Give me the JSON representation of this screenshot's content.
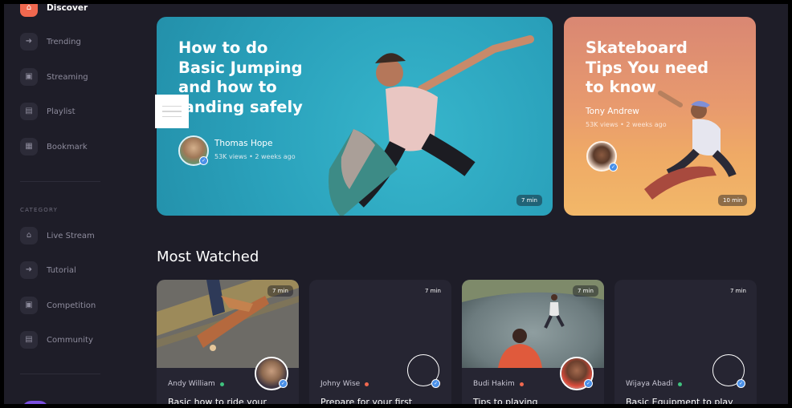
{
  "sidebar": {
    "main_items": [
      {
        "label": "Discover",
        "icon": "home-icon"
      },
      {
        "label": "Trending",
        "icon": "arrow-right-icon"
      },
      {
        "label": "Streaming",
        "icon": "tv-icon"
      },
      {
        "label": "Playlist",
        "icon": "document-icon"
      },
      {
        "label": "Bookmark",
        "icon": "bookmark-icon"
      }
    ],
    "category_label": "CATEGORY",
    "category_items": [
      {
        "label": "Live Stream",
        "icon": "home-icon"
      },
      {
        "label": "Tutorial",
        "icon": "arrow-right-icon"
      },
      {
        "label": "Competition",
        "icon": "tv-icon"
      },
      {
        "label": "Community",
        "icon": "document-icon"
      }
    ]
  },
  "hero_main": {
    "title": "How to do\nBasic Jumping\nand how to\nlanding safely",
    "author": "Thomas Hope",
    "meta": "53K views  •  2 weeks ago",
    "duration": "7 min"
  },
  "hero_side": {
    "title": "Skateboard\nTips You need\nto know",
    "author": "Tony Andrew",
    "meta": "53K views  •  2 weeks ago",
    "duration": "10 min"
  },
  "section_title": "Most Watched",
  "most_watched": [
    {
      "author": "Andy William",
      "status_color": "#3fc27e",
      "title": "Basic how to ride your",
      "duration": "7 min"
    },
    {
      "author": "Johny Wise",
      "status_color": "#f0684f",
      "title": "Prepare for your first",
      "duration": "7 min"
    },
    {
      "author": "Budi Hakim",
      "status_color": "#f0684f",
      "title": "Tips to playing",
      "duration": "7 min"
    },
    {
      "author": "Wijaya Abadi",
      "status_color": "#3fc27e",
      "title": "Basic Equipment to play",
      "duration": "7 min"
    }
  ],
  "colors": {
    "accent": "#f0684f",
    "background": "#1e1d28",
    "card": "#262532",
    "hero_main": "#2aa3bd",
    "verified": "#4a90e8"
  }
}
